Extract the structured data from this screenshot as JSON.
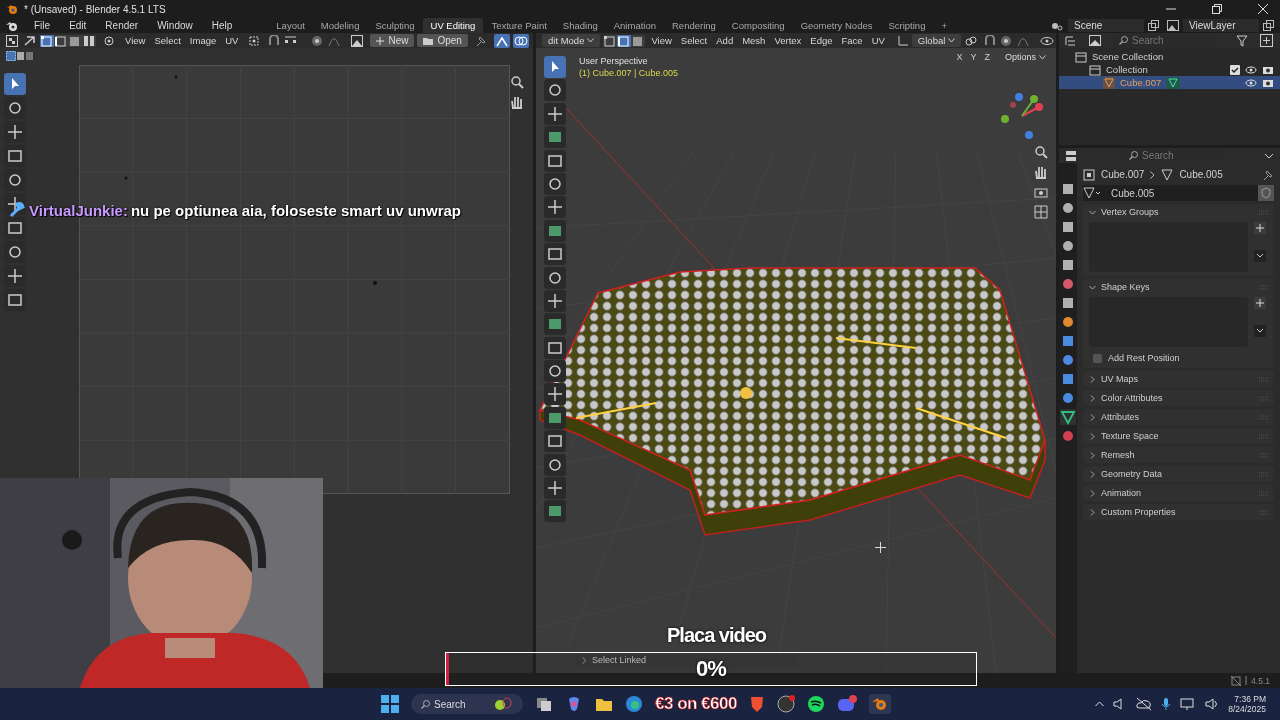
{
  "window": {
    "title": "* (Unsaved) - Blender 4.5.1 LTS"
  },
  "menu": [
    "File",
    "Edit",
    "Render",
    "Window",
    "Help"
  ],
  "workspaces": [
    {
      "label": "Layout",
      "selected": false
    },
    {
      "label": "Modeling",
      "selected": false
    },
    {
      "label": "Sculpting",
      "selected": false
    },
    {
      "label": "UV Editing",
      "selected": true
    },
    {
      "label": "Texture Paint",
      "selected": false
    },
    {
      "label": "Shading",
      "selected": false
    },
    {
      "label": "Animation",
      "selected": false
    },
    {
      "label": "Rendering",
      "selected": false
    },
    {
      "label": "Compositing",
      "selected": false
    },
    {
      "label": "Geometry Nodes",
      "selected": false
    },
    {
      "label": "Scripting",
      "selected": false
    }
  ],
  "add_workspace": "+",
  "scene": "Scene",
  "view_layer": "ViewLayer",
  "uv_editor": {
    "menus": [
      "View",
      "Select",
      "Image",
      "UV"
    ],
    "new_button": "New",
    "open_button": "Open"
  },
  "viewport": {
    "mode": "dit Mode",
    "menus": [
      "View",
      "Select",
      "Add",
      "Mesh",
      "Vertex",
      "Edge",
      "Face",
      "UV"
    ],
    "orientation": "Global",
    "axes": [
      "X",
      "Y",
      "Z"
    ],
    "options": "Options",
    "perspective": "User Perspective",
    "object_info": "(1) Cube.007 | Cube.005",
    "last_operator": "Select Linked"
  },
  "outliner": {
    "search_placeholder": "Search",
    "items": [
      {
        "label": "Scene Collection",
        "selected": false,
        "children": [
          {
            "label": "Collection",
            "selected": false,
            "children": [
              {
                "label": "Cube.007",
                "selected": true
              }
            ]
          }
        ]
      }
    ]
  },
  "properties": {
    "search_placeholder": "Search",
    "breadcrumb": [
      "Cube.007",
      "Cube.005"
    ],
    "mesh_name": "Cube.005",
    "panels": [
      {
        "label": "Vertex Groups",
        "expanded": true
      },
      {
        "label": "Shape Keys",
        "expanded": true,
        "option": {
          "label": "Add Rest Position",
          "checked": false
        }
      },
      {
        "label": "UV Maps",
        "expanded": false
      },
      {
        "label": "Color Attributes",
        "expanded": false
      },
      {
        "label": "Attributes",
        "expanded": false
      },
      {
        "label": "Texture Space",
        "expanded": false
      },
      {
        "label": "Remesh",
        "expanded": false
      },
      {
        "label": "Geometry Data",
        "expanded": false
      },
      {
        "label": "Animation",
        "expanded": false
      },
      {
        "label": "Custom Properties",
        "expanded": false
      }
    ]
  },
  "status_bar": {
    "version": "4.5.1"
  },
  "overlay": {
    "chat": {
      "user": "VirtualJunkie:",
      "message": "nu pe optiunea aia, foloseste smart uv unwrap"
    },
    "goal": {
      "title": "Placa video",
      "level": 0,
      "reading": "0%"
    }
  },
  "taskbar": {
    "search_placeholder": "Search",
    "promo": "€3 on €600",
    "time": "7:36 PM",
    "date": "8/24/2025"
  }
}
